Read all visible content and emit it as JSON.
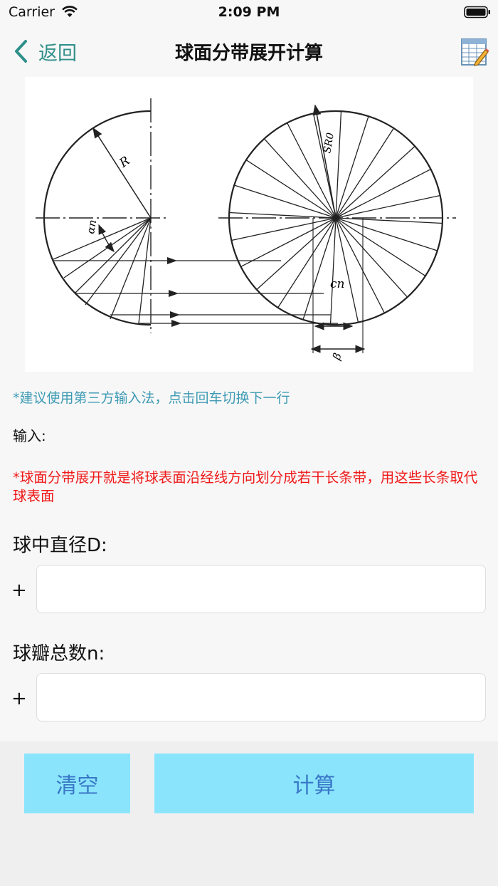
{
  "status_bar": {
    "carrier": "Carrier",
    "time": "2:09 PM"
  },
  "nav": {
    "back_label": "返回",
    "title": "球面分带展开计算"
  },
  "diagram": {
    "label_R": "R",
    "label_alpha": "αn",
    "label_SR": "SR0",
    "label_c": "cn",
    "label_beta": "β"
  },
  "hint": "*建议使用第三方输入法，点击回车切换下一行",
  "input_label": "输入:",
  "note": "*球面分带展开就是将球表面沿经线方向划分成若干长条带，用这些长条取代球表面",
  "fields": [
    {
      "label": "球中直径D:",
      "prefix": "+",
      "value": "",
      "placeholder": ""
    },
    {
      "label": "球瓣总数n:",
      "prefix": "+",
      "value": "",
      "placeholder": ""
    }
  ],
  "buttons": {
    "clear": "清空",
    "calculate": "计算"
  },
  "colors": {
    "accent": "#2f8f8a",
    "hint": "#3d9ab4",
    "note": "#f01818",
    "button_bg": "#8ae5fc",
    "button_text": "#3a78c8"
  }
}
